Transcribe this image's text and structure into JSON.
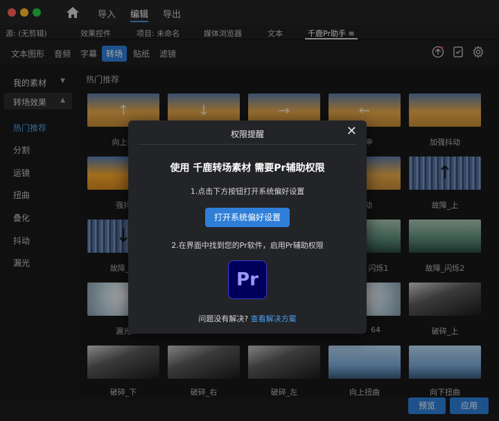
{
  "titlebar": {
    "menu": [
      "导入",
      "编辑",
      "导出"
    ],
    "active_menu": "编辑"
  },
  "panel_tabs": [
    "源: (无剪辑)",
    "效果控件",
    "项目: 未命名",
    "媒体浏览器",
    "文本",
    "千鹿Pr助手 ≡"
  ],
  "categories": [
    "文本图形",
    "音频",
    "字幕",
    "转场",
    "贴纸",
    "滤镜"
  ],
  "active_category": "转场",
  "sidebar": {
    "my_assets": "我的素材",
    "transition_effects": "转场效果",
    "items": [
      "热门推荐",
      "分割",
      "运镜",
      "扭曲",
      "叠化",
      "抖动",
      "漏光"
    ],
    "active_item": "热门推荐"
  },
  "section_title": "热门推荐",
  "thumbnails": [
    [
      "向上拉伸",
      "向下拉伸",
      "向右拉伸",
      "向左拉伸",
      "加强抖动"
    ],
    [
      "强抖动",
      "",
      "",
      "抖动",
      "故障_上"
    ],
    [
      "故障_下",
      "",
      "",
      "闪烁1",
      "故障_闪烁2"
    ],
    [
      "漏光",
      "",
      "",
      "闪烁4",
      "破碎_上"
    ],
    [
      "破碎_下",
      "破碎_右",
      "破碎_左",
      "向上扭曲",
      "向下扭曲"
    ]
  ],
  "visible_labels": [
    [
      "向上拉",
      "",
      "",
      "拉伸",
      "加强抖动"
    ],
    [
      "强抖",
      "",
      "",
      "抖动",
      "故障_上"
    ],
    [
      "故障_下",
      "",
      "",
      "闪烁1",
      "故障_闪烁2"
    ],
    [
      "漏光",
      "",
      "",
      "64",
      "破碎_上"
    ],
    [
      "破碎_下",
      "破碎_右",
      "破碎_左",
      "向上扭曲",
      "向下扭曲"
    ]
  ],
  "buttons": {
    "preview": "预览",
    "apply": "应用"
  },
  "modal": {
    "title": "权限提醒",
    "close": "✕",
    "heading": "使用 千鹿转场素材 需要Pr辅助权限",
    "step1": "1.点击下方按钮打开系统偏好设置",
    "open_prefs": "打开系统偏好设置",
    "step2": "2.在界面中找到您的Pr软件，启用Pr辅助权限",
    "logo_text": "Pr",
    "help_prefix": "问题没有解决?",
    "help_link": "查看解决方案"
  },
  "colors": {
    "accent": "#2f7fd8",
    "link": "#4a9ff0",
    "pr_bg": "#00005b",
    "pr_text": "#9999ff"
  }
}
